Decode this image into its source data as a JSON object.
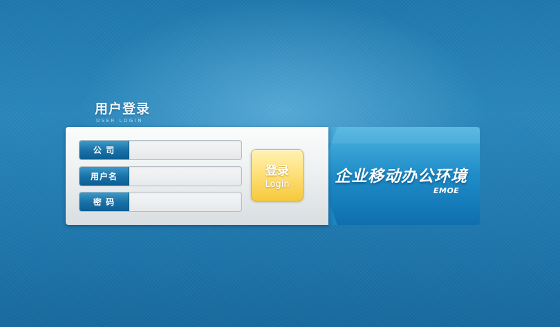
{
  "header": {
    "title": "用户登录",
    "subtitle": "USER LOGIN"
  },
  "form": {
    "company_label": "公  司",
    "username_label": "用户名",
    "password_label": "密  码",
    "company_value": "",
    "username_value": "",
    "password_value": ""
  },
  "login_button": {
    "label_zh": "登录",
    "label_en": "Login"
  },
  "banner": {
    "title": "企业移动办公环境",
    "subtitle": "EMOE"
  },
  "colors": {
    "background": "#2a86bb",
    "label_blue": "#1a72a8",
    "button_yellow": "#ffe17c"
  }
}
